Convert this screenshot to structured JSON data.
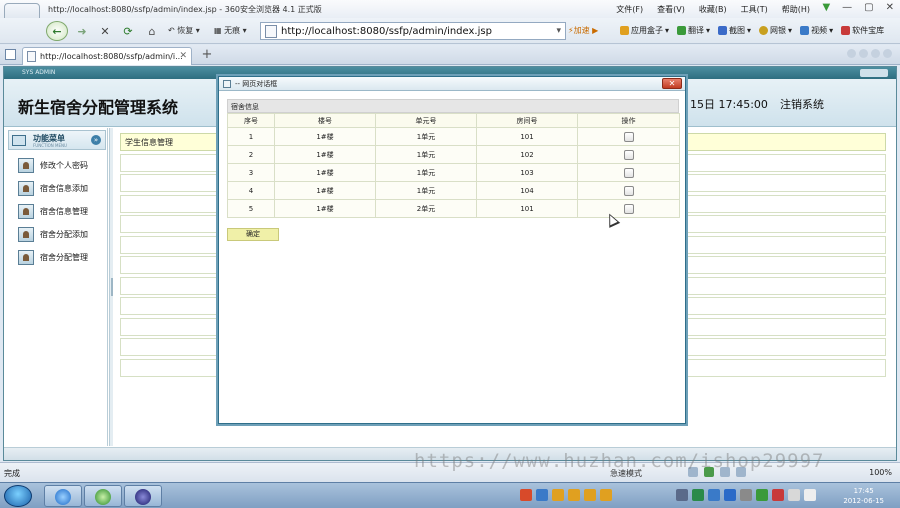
{
  "browser": {
    "title": "http://localhost:8080/ssfp/admin/index.jsp - 360安全浏览器 4.1 正式版",
    "menus": [
      "文件(F)",
      "查看(V)",
      "收藏(B)",
      "工具(T)",
      "帮助(H)"
    ],
    "window_controls": [
      "▼",
      "—",
      "▢",
      "✕"
    ],
    "nav": {
      "back": "←",
      "forward": "➜",
      "stop": "✕",
      "refresh": "⟳",
      "home": "⌂",
      "restore_label": "恢复",
      "no_trace_label": "无痕"
    },
    "address": "http://localhost:8080/ssfp/admin/index.jsp",
    "accelerate": "加速",
    "toolbar_right": [
      {
        "label": "应用盒子",
        "color": "#e0a020"
      },
      {
        "label": "翻译",
        "color": "#3a9a3a"
      },
      {
        "label": "截图",
        "color": "#3a6ac8"
      },
      {
        "label": "网银",
        "color": "#c8a020"
      },
      {
        "label": "视频",
        "color": "#3a7ac8"
      },
      {
        "label": "软件宝库",
        "color": "#c83a3a"
      }
    ],
    "tab": {
      "title": "http://localhost:8080/ssfp/admin/i...",
      "close": "✕"
    },
    "new_tab": "+"
  },
  "app": {
    "strip_label": "SYS ADMIN",
    "system_title": "新生宿舍分配管理系统",
    "datetime": "15日  17:45:00",
    "logout": "注销系统",
    "menu_head": {
      "title": "功能菜单",
      "subtitle": "FUNCTION MENU",
      "collapse": "»"
    },
    "menu_items": [
      "修改个人密码",
      "宿舍信息添加",
      "宿舍信息管理",
      "宿舍分配添加",
      "宿舍分配管理"
    ],
    "content_title": "学生信息管理",
    "content_row_count": 12
  },
  "dialog": {
    "title": "-- 网页对话框",
    "close": "✕",
    "caption": "宿舍信息",
    "columns": [
      "序号",
      "楼号",
      "单元号",
      "房间号",
      "操作"
    ],
    "rows": [
      {
        "no": "1",
        "building": "1#楼",
        "unit": "1单元",
        "room": "101"
      },
      {
        "no": "2",
        "building": "1#楼",
        "unit": "1单元",
        "room": "102"
      },
      {
        "no": "3",
        "building": "1#楼",
        "unit": "1单元",
        "room": "103"
      },
      {
        "no": "4",
        "building": "1#楼",
        "unit": "1单元",
        "room": "104"
      },
      {
        "no": "5",
        "building": "1#楼",
        "unit": "2单元",
        "room": "101"
      }
    ],
    "ok_button": "确定"
  },
  "status": {
    "done": "完成",
    "mode": "急速模式",
    "zoom": "100%"
  },
  "watermark": "https://www.huzhan.com/ishop29997",
  "taskbar": {
    "time": "17:45",
    "date": "2012-06-15"
  }
}
